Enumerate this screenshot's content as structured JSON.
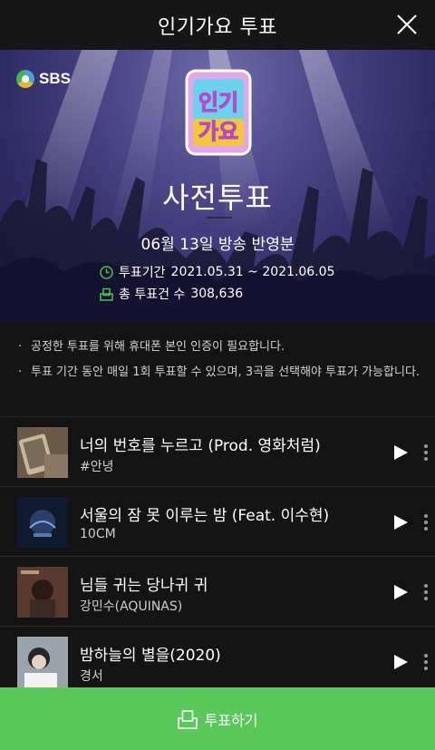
{
  "header": {
    "title": "인기가요 투표",
    "close_icon": "close-icon"
  },
  "hero": {
    "broadcaster": "SBS",
    "logo_text": "인기가요",
    "title": "사전투표",
    "subtitle": "06월 13일 방송 반영분",
    "period_label": "투표기간",
    "period_value": "2021.05.31 ~ 2021.06.05",
    "total_label": "총 투표건 수",
    "total_value": "308,636"
  },
  "notes": [
    "공정한 투표를 위해 휴대폰 본인 인증이 필요합니다.",
    "투표 기간 동안 매일 1회 투표할 수 있으며, 3곡을 선택해야 투표가 가능합니다."
  ],
  "songs": [
    {
      "title": "너의 번호를 누르고 (Prod. 영화처럼)",
      "artist": "#안녕"
    },
    {
      "title": "서울의 잠 못 이루는 밤 (Feat. 이수현)",
      "artist": "10CM"
    },
    {
      "title": "님들 귀는 당나귀 귀",
      "artist": "강민수(AQUINAS)"
    },
    {
      "title": "밤하늘의 별을(2020)",
      "artist": "경서"
    }
  ],
  "vote_button": {
    "label": "투표하기"
  },
  "colors": {
    "accent": "#5bc85a",
    "icon_green": "#4fc04f",
    "background": "#141414",
    "hero_purple": "#3a3678"
  }
}
